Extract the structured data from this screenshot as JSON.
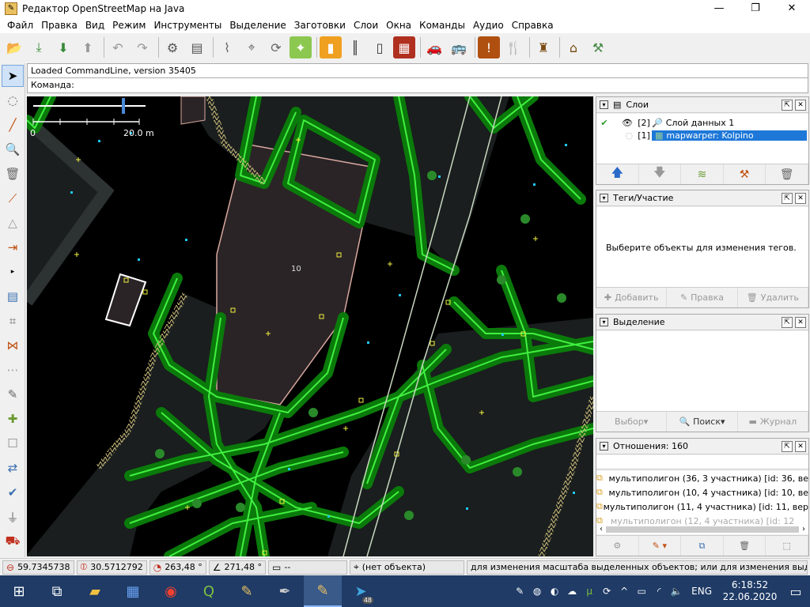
{
  "window": {
    "title": "Редактор OpenStreetMap на Java",
    "minimize": "—",
    "maximize": "❐",
    "close": "✕"
  },
  "menu": [
    "Файл",
    "Правка",
    "Вид",
    "Режим",
    "Инструменты",
    "Выделение",
    "Заготовки",
    "Слои",
    "Окна",
    "Команды",
    "Аудио",
    "Справка"
  ],
  "toolbar_icons": [
    "open-icon",
    "save-icon",
    "download-icon",
    "upload-icon",
    "undo-icon",
    "redo-icon",
    "preferences-icon",
    "layers-icon",
    "path-icon",
    "tag-icon",
    "refresh-icon",
    "satellite-icon",
    "traffic-icon",
    "road-icon",
    "building-icon",
    "car-icon",
    "bus-icon",
    "info-icon",
    "restaurant-icon",
    "castle-icon",
    "factory-icon",
    "tool-icon"
  ],
  "command": {
    "info": "Loaded CommandLine, version 35405",
    "prompt": "Команда:"
  },
  "map": {
    "scale_start": "0",
    "scale_end": "20.0 m",
    "building_label": "10"
  },
  "layers_panel": {
    "title": "Слои",
    "items": [
      {
        "index": "[2]",
        "name": "Слой данных 1",
        "visible": true
      },
      {
        "index": "[1]",
        "name": "mapwarper: Kolpino",
        "visible": false,
        "selected": true
      }
    ]
  },
  "tags_panel": {
    "title": "Теги/Участие",
    "empty_text": "Выберите объекты для изменения тегов.",
    "add": "Добавить",
    "edit": "Правка",
    "delete": "Удалить"
  },
  "selection_panel": {
    "title": "Выделение",
    "select": "Выбор",
    "search": "Поиск",
    "history": "Журнал"
  },
  "relations_panel": {
    "title": "Отношения: 160",
    "items": [
      "мультиполигон (36, 3 участника) [id: 36, ве",
      "мультиполигон (10, 4 участника) [id: 10, ве",
      "мультиполигон (11, 4 участника) [id: 11, вер",
      "мультиполигон (12, 4 участника) [id: 12"
    ]
  },
  "status": {
    "lat": "59.7345738",
    "lon": "30.5712792",
    "heading": "263,48 °",
    "angle": "271,48 °",
    "distance": "--",
    "object": "(нет объекта)",
    "hint": "для изменения масштаба выделенных объектов; или для изменения выделения"
  },
  "taskbar": {
    "apps": [
      "windows-icon",
      "task-view-icon",
      "file-explorer-icon",
      "app-icon",
      "chrome-icon",
      "qgis-icon",
      "josm-icon",
      "inkscape-icon",
      "josm-active-icon",
      "telegram-icon"
    ],
    "telegram_badge": "48",
    "language": "ENG",
    "time": "6:18:52",
    "date": "22.06.2020"
  }
}
